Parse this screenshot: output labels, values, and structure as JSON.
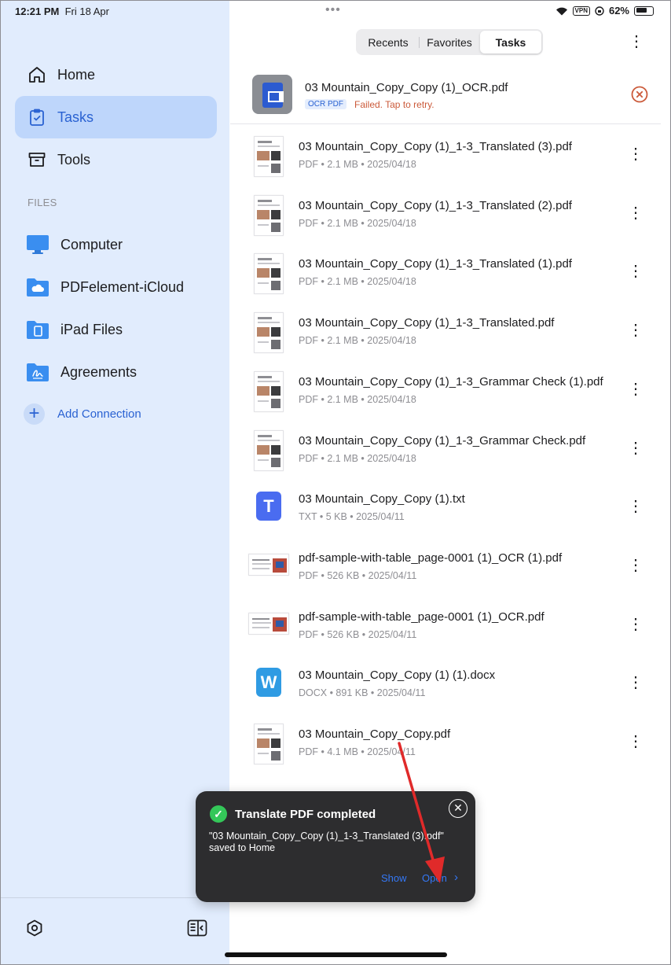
{
  "status_bar": {
    "time": "12:21 PM",
    "date": "Fri 18 Apr",
    "vpn": "VPN",
    "battery": "62%"
  },
  "sidebar": {
    "nav": [
      {
        "label": "Home",
        "icon": "home-icon"
      },
      {
        "label": "Tasks",
        "icon": "tasks-icon",
        "active": true
      },
      {
        "label": "Tools",
        "icon": "tools-icon"
      }
    ],
    "files_header": "FILES",
    "folders": [
      {
        "label": "Computer",
        "icon": "monitor-icon"
      },
      {
        "label": "PDFelement-iCloud",
        "icon": "cloud-folder-icon"
      },
      {
        "label": "iPad Files",
        "icon": "ipad-folder-icon"
      },
      {
        "label": "Agreements",
        "icon": "signature-folder-icon"
      }
    ],
    "add_connection": "Add Connection"
  },
  "tabs": [
    {
      "label": "Recents"
    },
    {
      "label": "Favorites"
    },
    {
      "label": "Tasks",
      "active": true
    }
  ],
  "failed_task": {
    "name": "03 Mountain_Copy_Copy (1)_OCR.pdf",
    "tag": "OCR PDF",
    "message": "Failed. Tap to retry."
  },
  "files": [
    {
      "name": "03 Mountain_Copy_Copy (1)_1-3_Translated (3).pdf",
      "meta": "PDF • 2.1 MB • 2025/04/18",
      "kind": "pdf"
    },
    {
      "name": "03 Mountain_Copy_Copy (1)_1-3_Translated (2).pdf",
      "meta": "PDF • 2.1 MB • 2025/04/18",
      "kind": "pdf"
    },
    {
      "name": "03 Mountain_Copy_Copy (1)_1-3_Translated (1).pdf",
      "meta": "PDF • 2.1 MB • 2025/04/18",
      "kind": "pdf"
    },
    {
      "name": "03 Mountain_Copy_Copy (1)_1-3_Translated.pdf",
      "meta": "PDF • 2.1 MB • 2025/04/18",
      "kind": "pdf"
    },
    {
      "name": "03 Mountain_Copy_Copy (1)_1-3_Grammar Check (1).pdf",
      "meta": "PDF • 2.1 MB • 2025/04/18",
      "kind": "pdf"
    },
    {
      "name": "03 Mountain_Copy_Copy (1)_1-3_Grammar Check.pdf",
      "meta": "PDF • 2.1 MB • 2025/04/18",
      "kind": "pdf"
    },
    {
      "name": "03 Mountain_Copy_Copy (1).txt",
      "meta": "TXT • 5 KB • 2025/04/11",
      "kind": "txt",
      "icon_letter": "T"
    },
    {
      "name": "pdf-sample-with-table_page-0001 (1)_OCR (1).pdf",
      "meta": "PDF • 526 KB • 2025/04/11",
      "kind": "pdf-wide"
    },
    {
      "name": "pdf-sample-with-table_page-0001 (1)_OCR.pdf",
      "meta": "PDF • 526 KB • 2025/04/11",
      "kind": "pdf-wide"
    },
    {
      "name": "03 Mountain_Copy_Copy (1) (1).docx",
      "meta": "DOCX • 891 KB • 2025/04/11",
      "kind": "docx",
      "icon_letter": "W"
    },
    {
      "name": "03 Mountain_Copy_Copy.pdf",
      "meta": "PDF • 4.1 MB • 2025/04/11",
      "kind": "pdf"
    }
  ],
  "toast": {
    "title": "Translate PDF completed",
    "message": "\"03 Mountain_Copy_Copy (1)_1-3_Translated (3).pdf\" saved to Home",
    "show_label": "Show",
    "open_label": "Open"
  },
  "colors": {
    "sidebar_bg": "#e1ecfd",
    "active_bg": "#bed6fb",
    "accent": "#2a62d2",
    "error": "#cb5a3a",
    "txt_icon": "#4a6cf0",
    "docx_icon": "#2f9be3",
    "toast_bg": "#2d2d2f",
    "success": "#34c759",
    "annotation_arrow": "#e02a2a"
  }
}
